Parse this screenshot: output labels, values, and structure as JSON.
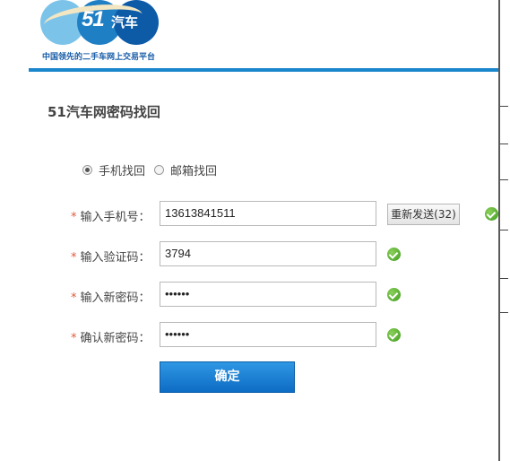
{
  "header": {
    "logo_text": "51",
    "logo_text2": "汽车",
    "slogan": "中国领先的二手车网上交易平台"
  },
  "page": {
    "title": "51汽车网密码找回"
  },
  "recovery_method": {
    "options": [
      {
        "label": "手机找回",
        "checked": true
      },
      {
        "label": "邮箱找回",
        "checked": false
      }
    ]
  },
  "form": {
    "required_mark": "*",
    "phone": {
      "label": "输入手机号：",
      "value": "13613841511"
    },
    "code": {
      "label": "输入验证码：",
      "value": "3794"
    },
    "new_password": {
      "label": "输入新密码：",
      "value": "••••••"
    },
    "confirm_password": {
      "label": "确认新密码：",
      "value": "••••••"
    },
    "resend_label": "重新发送(32)",
    "submit_label": "确定"
  },
  "colors": {
    "accent": "#1a86cc",
    "button": "#1a7fd4",
    "required": "#e05a3a",
    "valid": "#4caf24"
  },
  "icons": {
    "valid": "check-circle-icon",
    "radio": "radio-icon"
  }
}
